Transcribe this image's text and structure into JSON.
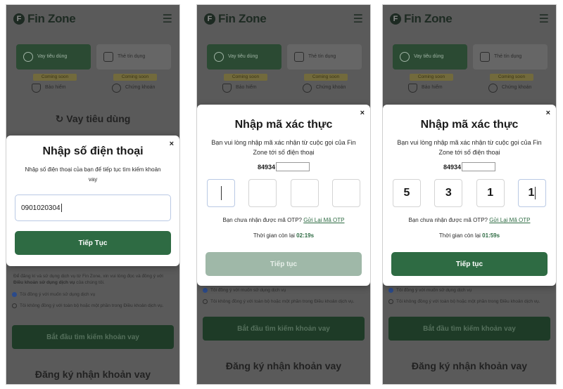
{
  "app": {
    "brand": "Fin Zone",
    "logo_letter": "F",
    "menu_icon": "hamburger-icon",
    "tiles": {
      "consumer_loan": "Vay tiêu dùng",
      "credit_card": "Thẻ tín dụng",
      "insurance": "Bảo hiểm",
      "securities": "Chứng khoán"
    },
    "coming_soon": "Coming soon",
    "section_heading": "Vay tiêu dùng",
    "terms_text_1": "Để đăng kí và sử dụng dịch vụ từ Fin Zone, xin vui lòng đọc và đồng ý với ",
    "terms_link": "Điều khoản sử dụng dịch vụ",
    "terms_text_2": " của chúng tôi.",
    "radio_agree": "Tôi đồng ý với muốn sử dụng dịch vụ",
    "radio_disagree": "Tôi không đồng ý với toàn bộ hoặc một phần trong Điều khoản dịch vụ.",
    "start_button": "Bắt đầu tìm kiếm khoản vay",
    "register_heading": "Đăng ký nhận khoản vay"
  },
  "phone_modal": {
    "title": "Nhập số điện thoại",
    "description": "Nhập số điện thoại của bạn để tiếp tục tìm kiếm khoản vay",
    "phone_value": "0901020304",
    "continue_label": "Tiếp Tục",
    "close_symbol": "×"
  },
  "otp_modal_empty": {
    "title": "Nhập mã xác thực",
    "description": "Bạn vui lòng nhập mã xác nhận từ cuộc gọi của Fin Zone tới số điện thoại",
    "phone_prefix": "84934",
    "digits": [
      "",
      "",
      "",
      ""
    ],
    "resend_question": "Bạn chưa nhận được mã OTP? ",
    "resend_link": "Gửi Lại Mã OTP",
    "timer_label": "Thời gian còn lại ",
    "timer_value": "02:19s",
    "continue_label": "Tiếp tục",
    "close_symbol": "×"
  },
  "otp_modal_filled": {
    "title": "Nhập mã xác thực",
    "description": "Bạn vui lòng nhập mã xác nhận từ cuộc gọi của Fin Zone tới số điện thoại",
    "phone_prefix": "84934",
    "digits": [
      "5",
      "3",
      "1",
      "1"
    ],
    "resend_question": "Bạn chưa nhận được mã OTP? ",
    "resend_link": "Gửi Lại Mã OTP",
    "timer_label": "Thời gian còn lại ",
    "timer_value": "01:59s",
    "continue_label": "Tiếp tục",
    "close_symbol": "×"
  },
  "colors": {
    "primary_green": "#2e6b43",
    "disabled_green": "#9fb8a8",
    "overlay_gray": "#5a5a5a",
    "coming_soon_badge": "#726a3c"
  }
}
